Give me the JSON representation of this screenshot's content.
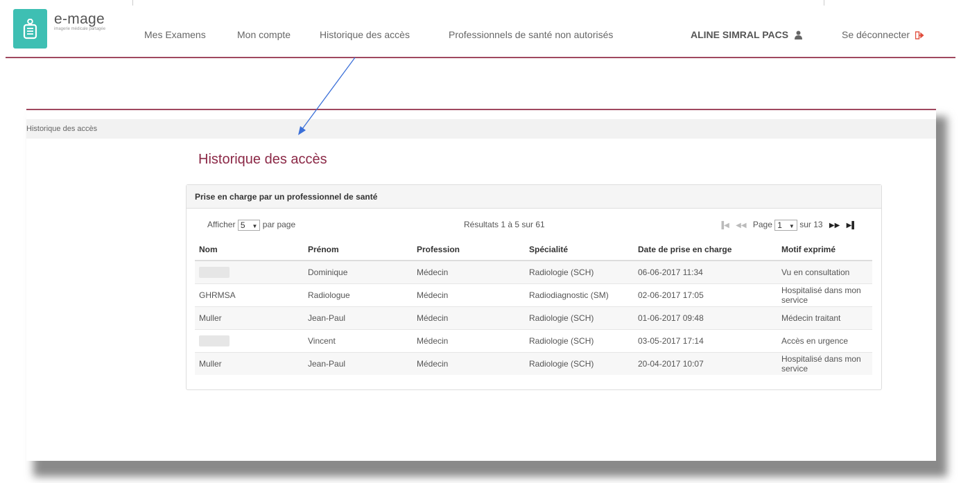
{
  "brand": {
    "name": "e-mage",
    "tagline": "imagerie médicale partagée"
  },
  "nav": {
    "items": [
      "Mes Examens",
      "Mon compte",
      "Historique des accès",
      "Professionnels de santé non autorisés"
    ],
    "user": "ALINE SIMRAL PACS",
    "logout": "Se déconnecter"
  },
  "breadcrumb": "Historique des accès",
  "page_title": "Historique des accès",
  "card": {
    "title": "Prise en charge par un professionnel de santé",
    "show_label": "Afficher",
    "show_value": "5",
    "per_page_label": "par page",
    "results": "Résultats 1 à 5 sur 61",
    "page_label": "Page",
    "page_value": "1",
    "page_total": "sur 13"
  },
  "table": {
    "columns": [
      "Nom",
      "Prénom",
      "Profession",
      "Spécialité",
      "Date de prise en charge",
      "Motif exprimé"
    ],
    "rows": [
      [
        "",
        "Dominique",
        "Médecin",
        "Radiologie (SCH)",
        "06-06-2017 11:34",
        "Vu en consultation"
      ],
      [
        "GHRMSA",
        "Radiologue",
        "Médecin",
        "Radiodiagnostic (SM)",
        "02-06-2017 17:05",
        "Hospitalisé dans mon service"
      ],
      [
        "Muller",
        "Jean-Paul",
        "Médecin",
        "Radiologie (SCH)",
        "01-06-2017 09:48",
        "Médecin traitant"
      ],
      [
        "",
        "Vincent",
        "Médecin",
        "Radiologie (SCH)",
        "03-05-2017 17:14",
        "Accès en urgence"
      ],
      [
        "Muller",
        "Jean-Paul",
        "Médecin",
        "Radiologie (SCH)",
        "20-04-2017 10:07",
        "Hospitalisé dans mon service"
      ]
    ]
  },
  "colors": {
    "accent": "#a0485f",
    "title": "#8b2846",
    "logo_bg": "#3ebfb3",
    "arrow": "#3a6fd8"
  },
  "icons": [
    "user-icon",
    "logout-icon",
    "first-page-icon",
    "prev-page-icon",
    "next-page-icon",
    "last-page-icon"
  ]
}
